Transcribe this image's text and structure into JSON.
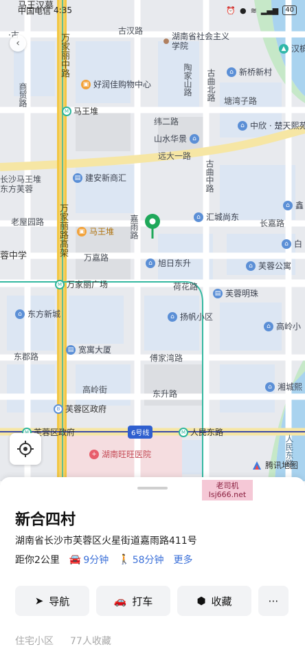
{
  "status_bar": {
    "carrier": "中国电信",
    "time": "4:35",
    "battery": "40"
  },
  "map": {
    "roads": {
      "guzhuang": "古汉路",
      "wanjiali_north": "万家丽中路",
      "shangxian": "商贸路",
      "taojia": "陶家山路",
      "guqu_north": "古曲北路",
      "tangwanzi": "塘湾子路",
      "weier": "纬二路",
      "yuandayi": "远大一路",
      "guqu_mid": "古曲中路",
      "laowu": "老屋园路",
      "wanjiali_viaduct": "万家丽路高架",
      "jiayu": "嘉雨路",
      "changjia": "长嘉路",
      "wanjia": "万嘉路",
      "hehua": "荷花路",
      "dongjun": "东郡路",
      "fujia": "傅家湾路",
      "dongsheng": "东升路",
      "gaoling": "高岭街",
      "renmin": "人民东路",
      "line6": "6号线"
    },
    "pois": {
      "shehui": "湖南省社会主义学院",
      "hanzhuang": "汉槟",
      "haorun": "好润佳购物中心",
      "xinqiao": "新桥新村",
      "mawangdui_metro": "马王堆",
      "zhongxin": "中欣 · 楚天熙苑",
      "shanshui": "山水华景",
      "changsha_mwd": "长沙马王堆",
      "dongfang_furong": "东方芙蓉",
      "jianan": "建安新商汇",
      "xin": "鑫",
      "huicheng": "汇城尚东",
      "mawangdui": "马王堆",
      "bai": "白",
      "zhongxue": "蓉中学",
      "xuri": "旭日东升",
      "furong_gongyu": "芙蓉公寓",
      "wanjiali_square": "万家丽广场",
      "furong_mingzhu": "芙蓉明珠",
      "dongfang_xincheng": "东方新城",
      "yangfan": "扬帆小区",
      "gaoling_xiao": "高岭小",
      "kuanyu": "宽寓大厦",
      "xiangcheng": "湘城熙",
      "furong_gov_bus": "芙蓉区政府",
      "furong_gov_metro": "芙蓉区政府",
      "renmin_metro": "人民东路",
      "hospital": "湖南旺旺医院",
      "mawangdui_top": "马王汉墓",
      "gu_top": "·古"
    },
    "brand": "腾讯地图"
  },
  "watermark": {
    "line1": "老司机",
    "line2": "lsj666.net"
  },
  "place": {
    "name": "新合四村",
    "address": "湖南省长沙市芙蓉区火星街道嘉雨路411号",
    "distance": "距你2公里",
    "drive_time": "9分钟",
    "walk_time": "58分钟",
    "more": "更多"
  },
  "actions": {
    "navigate": "导航",
    "taxi": "打车",
    "favorite": "收藏"
  },
  "footer": {
    "category": "住宅小区",
    "favorites": "77人收藏"
  },
  "colors": {
    "accent": "#3a6fd8",
    "pin": "#1fa85a",
    "road_main": "#f7d36a",
    "water": "#a9d3ef",
    "green": "#c6e8c8"
  }
}
